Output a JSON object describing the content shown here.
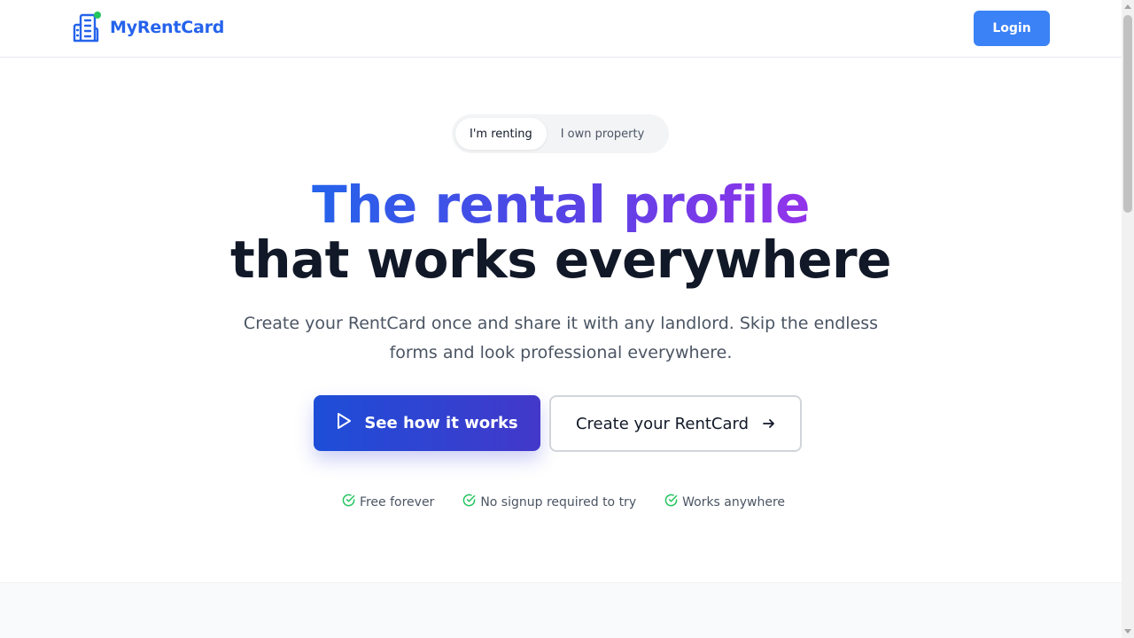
{
  "header": {
    "brand_name": "MyRentCard",
    "login_label": "Login"
  },
  "toggle": {
    "options": [
      {
        "label": "I'm renting",
        "active": true
      },
      {
        "label": "I own property",
        "active": false
      }
    ]
  },
  "hero": {
    "headline_gradient": "The rental profile",
    "headline_dark": "that works everywhere",
    "subtitle": "Create your RentCard once and share it with any landlord. Skip the endless forms and look professional everywhere.",
    "primary_cta": "See how it works",
    "secondary_cta": "Create your RentCard"
  },
  "perks": [
    {
      "label": "Free forever",
      "icon": "check-circle-icon"
    },
    {
      "label": "No signup required to try",
      "icon": "check-circle-icon"
    },
    {
      "label": "Works anywhere",
      "icon": "check-circle-icon"
    }
  ],
  "colors": {
    "brand": "#2563eb",
    "login_bg": "#3b82f6",
    "accent_green": "#22c55e",
    "gradient_start": "#2563eb",
    "gradient_end": "#9333ea",
    "headline_dark": "#111827",
    "muted_text": "#4b5563"
  }
}
